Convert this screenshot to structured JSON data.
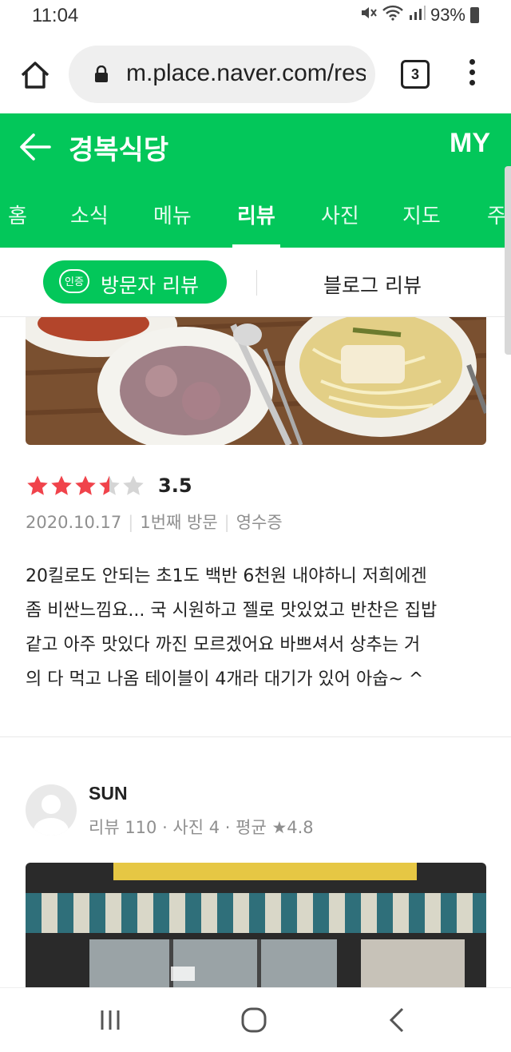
{
  "status_bar": {
    "time": "11:04",
    "battery": "93%"
  },
  "browser": {
    "url": "m.place.naver.com/res",
    "tab_count": "3"
  },
  "header": {
    "title": "경복식당",
    "my_label": "MY"
  },
  "nav_tabs": [
    {
      "label": "홈"
    },
    {
      "label": "소식"
    },
    {
      "label": "메뉴"
    },
    {
      "label": "리뷰",
      "active": true
    },
    {
      "label": "사진"
    },
    {
      "label": "지도"
    },
    {
      "label": "주변"
    }
  ],
  "review_tabs": {
    "badge": "인증",
    "visitor_label": "방문자 리뷰",
    "blog_label": "블로그 리뷰"
  },
  "review1": {
    "rating": 3.5,
    "rating_label": "3.5",
    "date": "2020.10.17",
    "visit": "1번째 방문",
    "proof": "영수증",
    "lines": [
      "20킬로도 안되는 초1도 백반 6천원 내야하니 저희에겐",
      "좀 비싼느낌요... 국 시원하고 젤로 맛있었고 반찬은 집밥",
      "같고 아주 맛있다 까진 모르겠어요 바쁘셔서 상추는 거",
      "의 다 먹고 나옴 테이블이 4개라 대기가 있어 아숩~ ^"
    ]
  },
  "review2": {
    "username": "SUN",
    "stats": "리뷰 110 · 사진 4 · 평균 ★4.8"
  },
  "colors": {
    "brand_green": "#03c75a",
    "star_red": "#f0434b",
    "star_gray": "#d5d5d5"
  }
}
